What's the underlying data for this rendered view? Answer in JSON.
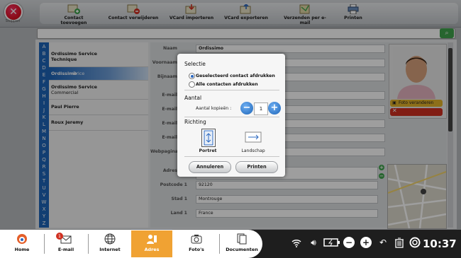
{
  "app": {
    "stop_label": "Stoppen"
  },
  "toolbar": {
    "add_contact": "Contact toevoegen",
    "delete_contact": "Contact verwijderen",
    "vcard_import": "VCard importeren",
    "vcard_export": "VCard exporteren",
    "send_email": "Verzenden per e-mail",
    "print": "Printen"
  },
  "alphabet": [
    "A",
    "B",
    "C",
    "D",
    "E",
    "F",
    "G",
    "H",
    "I",
    "J",
    "K",
    "L",
    "M",
    "N",
    "O",
    "P",
    "Q",
    "R",
    "S",
    "T",
    "U",
    "V",
    "W",
    "X",
    "Y",
    "Z"
  ],
  "contacts": [
    {
      "line1": "Ordissimo Service",
      "line2": "Technique"
    },
    {
      "line1": "Ordissimo",
      "line2": "Brice"
    },
    {
      "line1": "Ordissimo Service",
      "line2": "Commercial"
    },
    {
      "line1": "Paul Pierre",
      "line2": ""
    },
    {
      "line1": "Roux Jeremy",
      "line2": ""
    }
  ],
  "form": {
    "name_label": "Naam",
    "name_value": "Ordissimo",
    "first_label": "Voornaam",
    "company_label": "Bijnaam",
    "email_label": "E-mail",
    "website_label": "Webpagina",
    "address_label": "Adres",
    "postcode_label": "Postcode 1",
    "postcode_value": "92120",
    "city_label": "Stad 1",
    "city_value": "Montrouge",
    "country_label": "Land 1",
    "country_value": "France",
    "photo_change": "Foto veranderen"
  },
  "dialog": {
    "selection_title": "Selectie",
    "opt_selected": "Geselecteerd contact afdrukken",
    "opt_all": "Alle contacten afdrukken",
    "quantity_title": "Aantal",
    "copies_label": "Aantal kopieën :",
    "copies_value": "1",
    "orientation_title": "Richting",
    "portrait": "Portret",
    "landscape": "Landschap",
    "cancel": "Annuleren",
    "print": "Printen"
  },
  "taskbar": {
    "home": "Home",
    "email": "E-mail",
    "email_badge": "1",
    "internet": "Internet",
    "adres": "Adres",
    "photos": "Foto's",
    "documents": "Documenten",
    "clock": "10:37"
  },
  "colors": {
    "accent_blue": "#1d64b8",
    "active_tab": "#f0a233",
    "add_green": "#3fa34d",
    "delete_red": "#d03021"
  }
}
